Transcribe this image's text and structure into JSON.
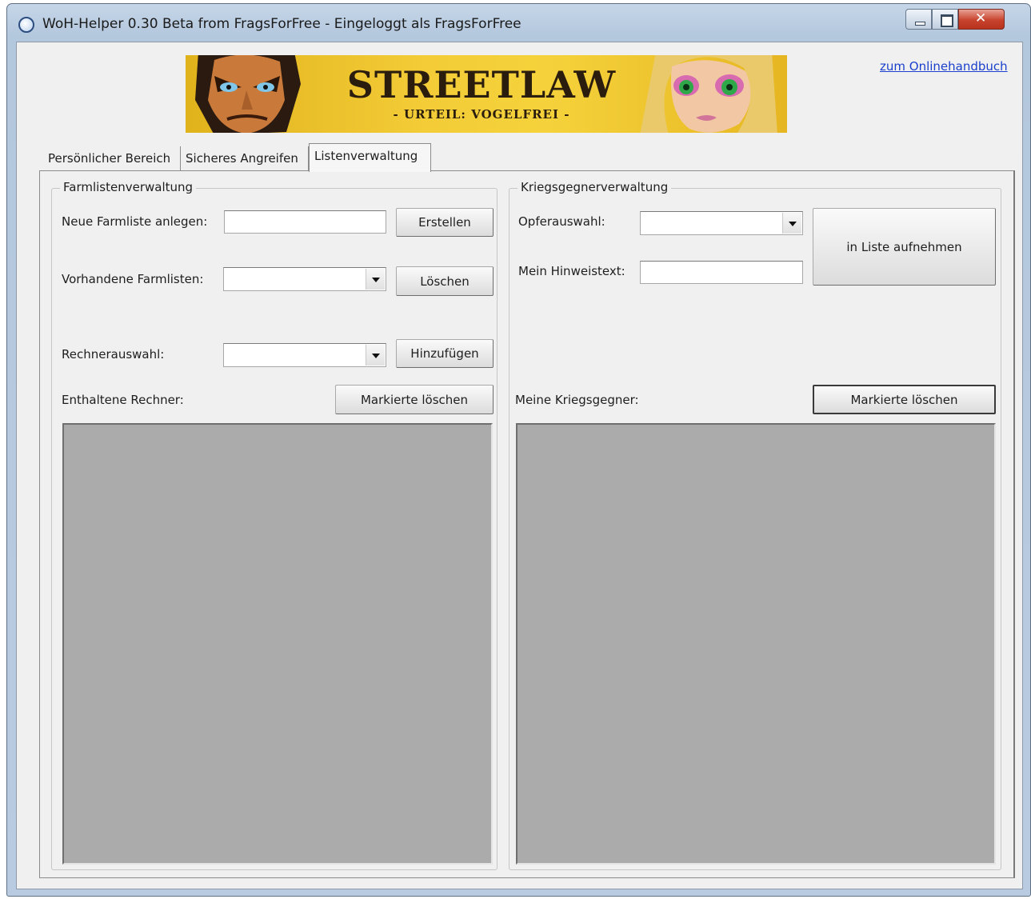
{
  "window": {
    "title": "WoH-Helper 0.30 Beta from FragsForFree - Eingeloggt als FragsForFree"
  },
  "banner": {
    "title": "STREETLAW",
    "subtitle": "- URTEIL: VOGELFREI -"
  },
  "help_link": "zum Onlinehandbuch",
  "tabs": [
    {
      "label": "Persönlicher Bereich",
      "selected": false
    },
    {
      "label": "Sicheres Angreifen",
      "selected": false
    },
    {
      "label": "Listenverwaltung",
      "selected": true
    }
  ],
  "farmlist": {
    "legend": "Farmlistenverwaltung",
    "new_label": "Neue Farmliste anlegen:",
    "new_value": "",
    "create_button": "Erstellen",
    "existing_label": "Vorhandene Farmlisten:",
    "existing_value": "",
    "delete_button": "Löschen",
    "computer_label": "Rechnerauswahl:",
    "computer_value": "",
    "add_button": "Hinzufügen",
    "contained_label": "Enthaltene Rechner:",
    "delete_marked_button": "Markierte löschen"
  },
  "enemies": {
    "legend": "Kriegsgegnerverwaltung",
    "victim_label": "Opferauswahl:",
    "victim_value": "",
    "note_label": "Mein Hinweistext:",
    "note_value": "",
    "add_to_list_button": "in Liste aufnehmen",
    "my_enemies_label": "Meine Kriegsgegner:",
    "delete_marked_button": "Markierte löschen"
  },
  "colors": {
    "banner_yellow": "#f3cc37",
    "listbox_gray": "#ababab",
    "link_blue": "#1a3fcc",
    "close_red": "#c8432d"
  }
}
